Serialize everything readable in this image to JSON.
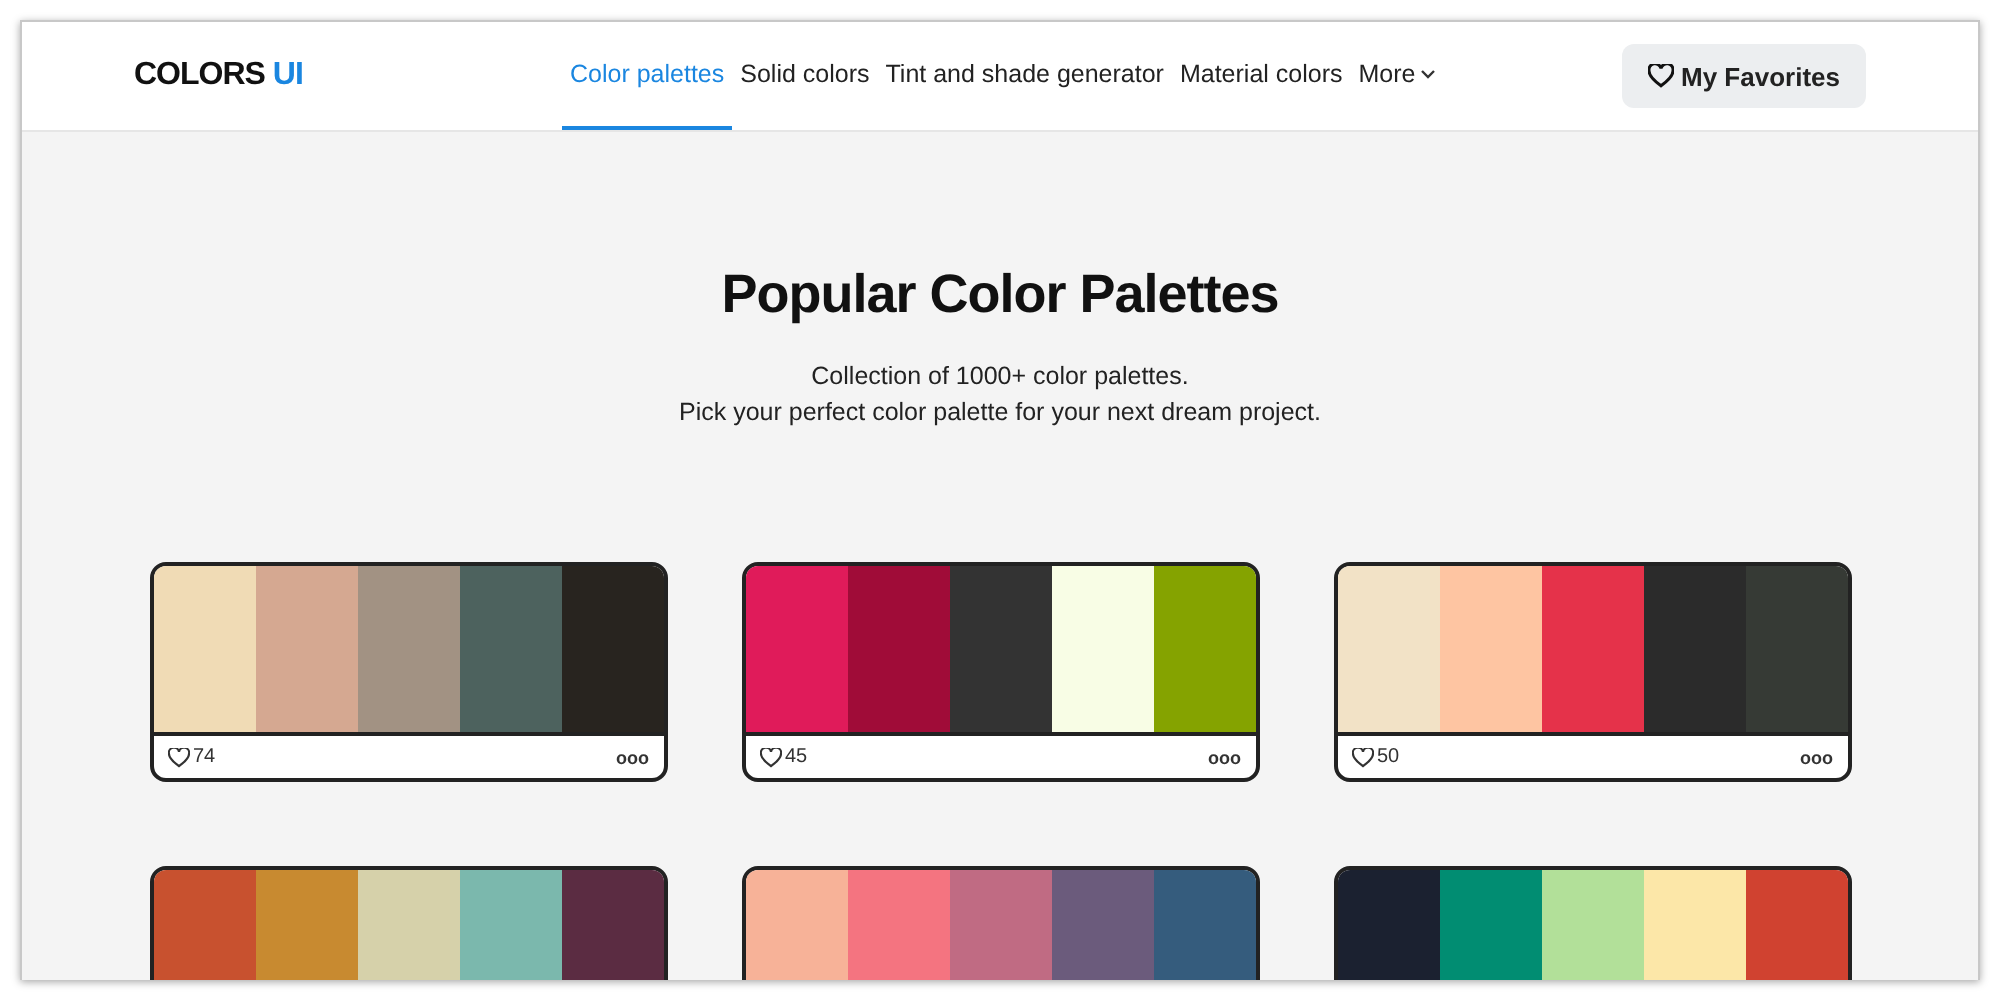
{
  "logo": {
    "text": "COLORS",
    "accent": "UI"
  },
  "nav": [
    {
      "label": "Color palettes",
      "selected": true
    },
    {
      "label": "Solid colors",
      "selected": false
    },
    {
      "label": "Tint and shade generator",
      "selected": false
    },
    {
      "label": "Material colors",
      "selected": false
    },
    {
      "label": "More",
      "selected": false,
      "kind": "dropdown"
    }
  ],
  "favorites_button": "My Favorites",
  "title": "Popular Color Palettes",
  "subtitle": [
    "Collection of 1000+ color palettes.",
    "Pick your perfect color palette for your next dream project."
  ],
  "palettes": [
    {
      "swatches": [
        {
          "color": "#f0dbb5"
        },
        {
          "color": "#d5a891"
        },
        {
          "color": "#a29283"
        },
        {
          "color": "#4d625e"
        },
        {
          "color": "#28241f"
        }
      ],
      "likes": "74",
      "menu": "ooo"
    },
    {
      "swatches": [
        {
          "color": "#e01b5a"
        },
        {
          "color": "#a00c38"
        },
        {
          "color": "#333333"
        },
        {
          "color": "#f8fde5"
        },
        {
          "color": "#85a300"
        }
      ],
      "likes": "45",
      "menu": "ooo"
    },
    {
      "swatches": [
        {
          "color": "#f2e2c6"
        },
        {
          "color": "#fec5a2"
        },
        {
          "color": "#e5324a"
        },
        {
          "color": "#2b2b2b"
        },
        {
          "color": "#363a35"
        }
      ],
      "likes": "50",
      "menu": "ooo"
    },
    {
      "swatches": [
        {
          "color": "#c8512f"
        },
        {
          "color": "#c88a30"
        },
        {
          "color": "#d6d1aa"
        },
        {
          "color": "#7bb8ad"
        },
        {
          "color": "#5b2c42"
        }
      ]
    },
    {
      "swatches": [
        {
          "color": "#f7b298"
        },
        {
          "color": "#f47480"
        },
        {
          "color": "#c06b83"
        },
        {
          "color": "#6b5b7c"
        },
        {
          "color": "#355c7d"
        }
      ]
    },
    {
      "swatches": [
        {
          "color": "#1b2130"
        },
        {
          "color": "#018d72"
        },
        {
          "color": "#b2e099"
        },
        {
          "color": "#fce7a8"
        },
        {
          "color": "#d04230"
        }
      ]
    }
  ]
}
